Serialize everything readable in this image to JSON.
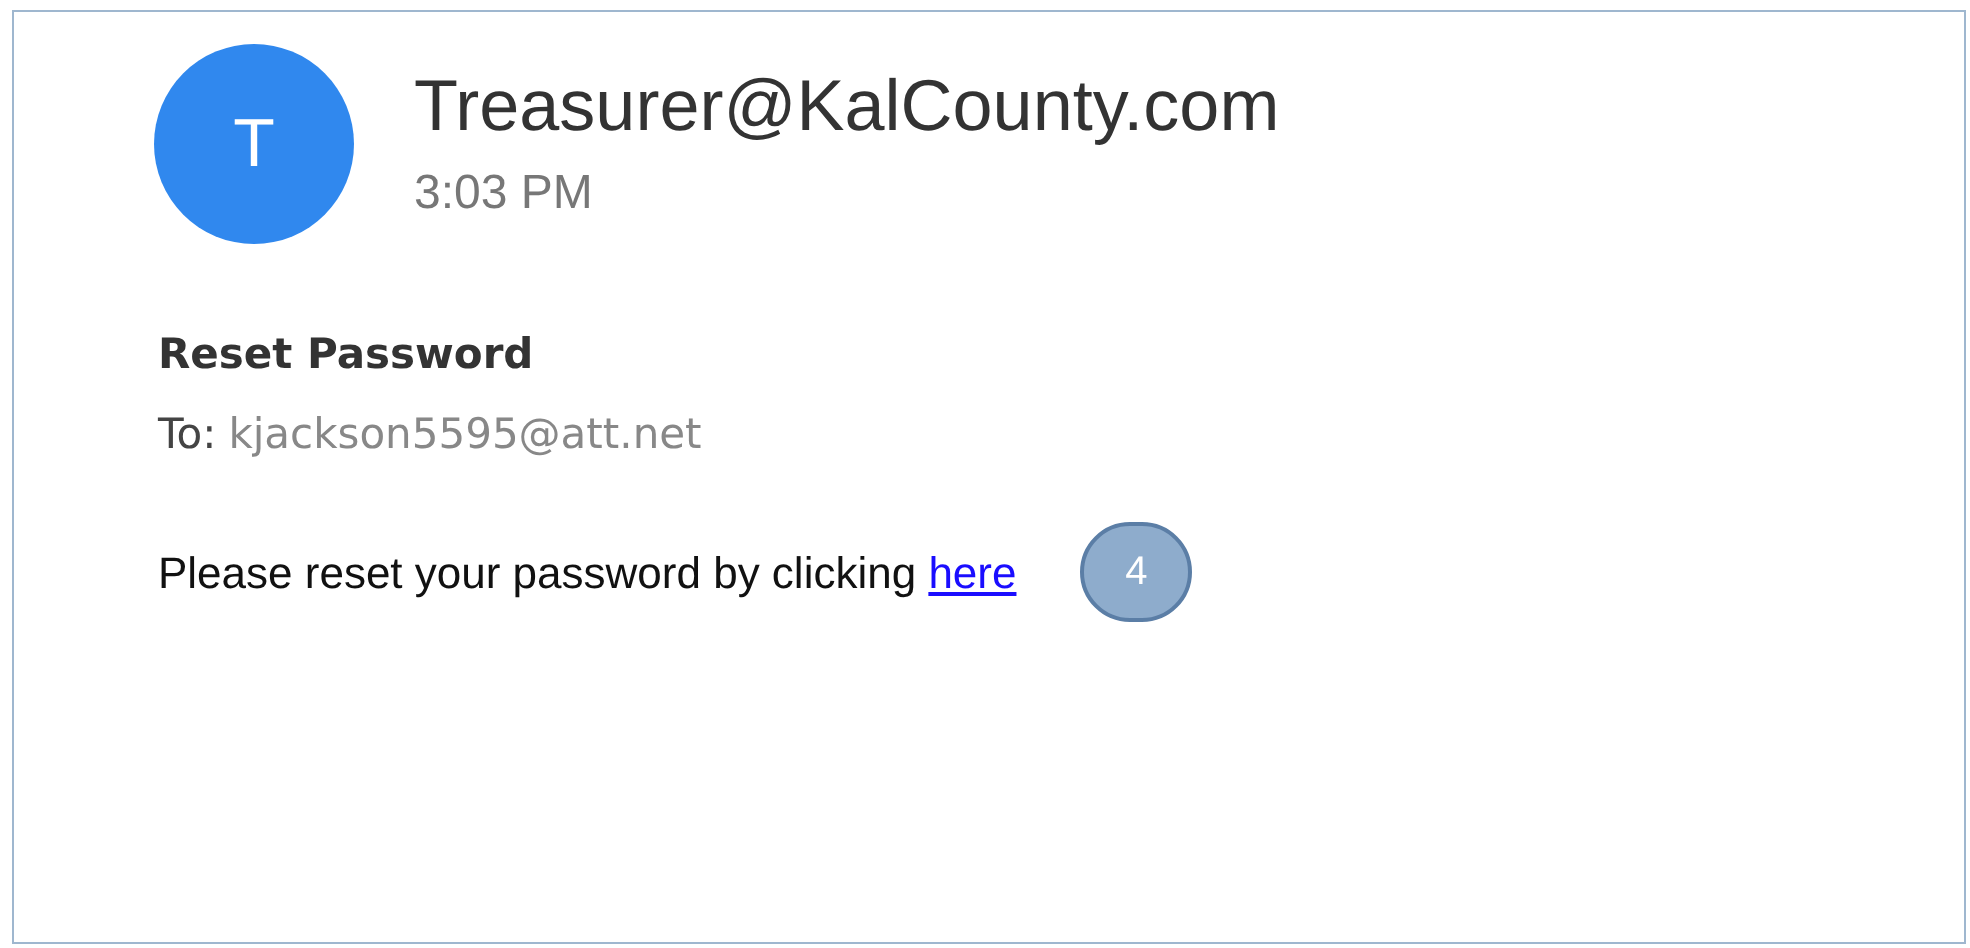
{
  "message": {
    "avatar_letter": "T",
    "sender": "Treasurer@KalCounty.com",
    "time": "3:03 PM",
    "subject": "Reset Password",
    "to_label": "To:",
    "to_address": "kjackson5595@att.net",
    "body": "Please reset your password by clicking",
    "link": "here"
  },
  "callout": {
    "number": "4"
  }
}
